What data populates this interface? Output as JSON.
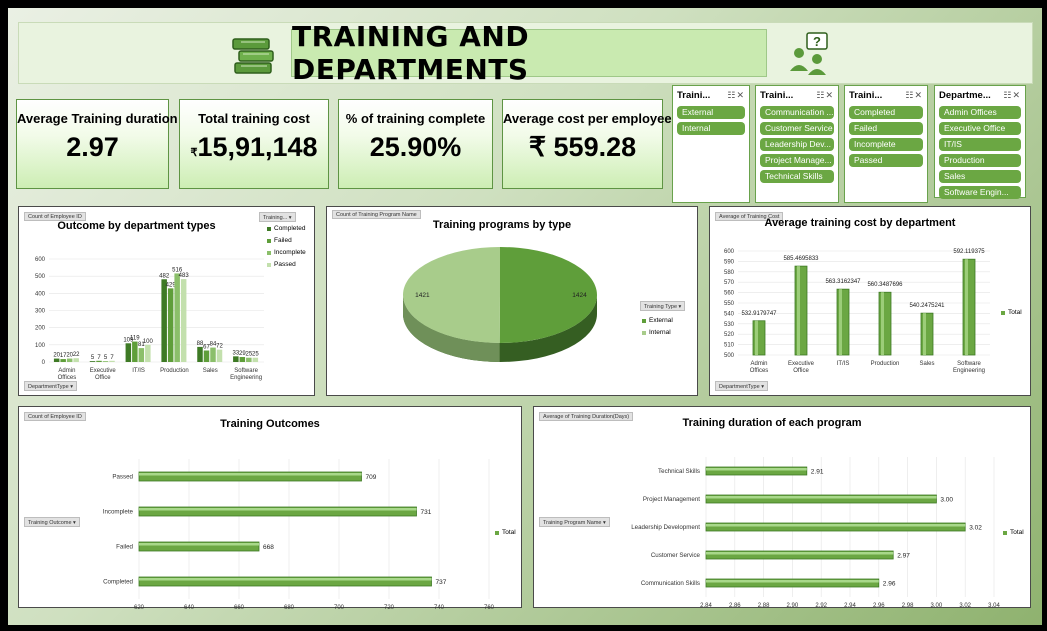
{
  "title": "TRAINING AND DEPARTMENTS",
  "colors": {
    "accent": "#6ba743",
    "dark": "#3e7a25",
    "light": "#a8d08d",
    "pale": "#cfe8bd"
  },
  "kpis": [
    {
      "label": "Average Training duration",
      "value": "2.97",
      "prefix": ""
    },
    {
      "label": "Total training cost",
      "value": "15,91,148",
      "prefix": "₹"
    },
    {
      "label": "% of training complete",
      "value": "25.90%",
      "prefix": ""
    },
    {
      "label": "Average cost per employee",
      "value": "₹ 559.28",
      "prefix": ""
    }
  ],
  "slicers": [
    {
      "title": "Traini...",
      "items": [
        "External",
        "Internal"
      ]
    },
    {
      "title": "Traini...",
      "items": [
        "Communication ...",
        "Customer Service",
        "Leadership Dev...",
        "Project Manage...",
        "Technical Skills"
      ]
    },
    {
      "title": "Traini...",
      "items": [
        "Completed",
        "Failed",
        "Incomplete",
        "Passed"
      ]
    },
    {
      "title": "Departme...",
      "items": [
        "Admin Offices",
        "Executive Office",
        "IT/IS",
        "Production",
        "Sales",
        "Software Engin..."
      ]
    }
  ],
  "panels": {
    "outcome": {
      "field": "Count of Employee ID",
      "drop_top": "Training...",
      "drop_bottom": "DepartmentType"
    },
    "programs": {
      "field": "Count of Training Program Name",
      "drop": "Training Type"
    },
    "avgcost": {
      "field": "Average of Training Cost",
      "drop": "DepartmentType"
    },
    "outcomes": {
      "field": "Count of Employee ID",
      "drop": "Training Outcome"
    },
    "duration": {
      "field": "Average of Training Duration(Days)",
      "drop": "Training Program Name"
    }
  },
  "chart_data": [
    {
      "type": "bar",
      "title": "Outcome by department types",
      "categories": [
        "Admin Offices",
        "Executive Office",
        "IT/IS",
        "Production",
        "Sales",
        "Software Engineering"
      ],
      "series": [
        {
          "name": "Completed",
          "values": [
            20,
            5,
            109,
            482,
            88,
            33
          ]
        },
        {
          "name": "Failed",
          "values": [
            17,
            7,
            119,
            429,
            67,
            29
          ]
        },
        {
          "name": "Incomplete",
          "values": [
            20,
            5,
            81,
            516,
            84,
            25
          ]
        },
        {
          "name": "Passed",
          "values": [
            22,
            7,
            100,
            483,
            72,
            25
          ]
        }
      ],
      "ylim": [
        0,
        600
      ],
      "yticks": [
        0,
        100,
        200,
        300,
        400,
        500,
        600
      ],
      "legend": "right"
    },
    {
      "type": "pie",
      "title": "Training programs by type",
      "categories": [
        "External",
        "Internal"
      ],
      "values": [
        1424,
        1421
      ],
      "legend": "right"
    },
    {
      "type": "bar",
      "title": "Average training cost by department",
      "categories": [
        "Admin Offices",
        "Executive Office",
        "IT/IS",
        "Production",
        "Sales",
        "Software Engineering"
      ],
      "series": [
        {
          "name": "Total",
          "values": [
            532.9179747,
            585.4695833,
            563.3162347,
            560.3487696,
            540.2475241,
            592.119375
          ]
        }
      ],
      "labels": [
        "532.9179747",
        "585.4695833",
        "563.3162347",
        "560.3487696",
        "540.2475241",
        "592.119375"
      ],
      "ylim": [
        500,
        600
      ],
      "yticks": [
        500,
        510,
        520,
        530,
        540,
        550,
        560,
        570,
        580,
        590,
        600
      ],
      "legend": "right"
    },
    {
      "type": "bar",
      "orientation": "horizontal",
      "title": "Training Outcomes",
      "categories": [
        "Passed",
        "Incomplete",
        "Failed",
        "Completed"
      ],
      "series": [
        {
          "name": "Total",
          "values": [
            709,
            731,
            668,
            737
          ]
        }
      ],
      "xlim": [
        620,
        760
      ],
      "xticks": [
        620,
        640,
        660,
        680,
        700,
        720,
        740,
        760
      ],
      "legend": "right"
    },
    {
      "type": "bar",
      "orientation": "horizontal",
      "title": "Training duration of each program",
      "categories": [
        "Technical Skills",
        "Project Management",
        "Leadership Development",
        "Customer Service",
        "Communication Skills"
      ],
      "series": [
        {
          "name": "Total",
          "values": [
            2.91,
            3.0,
            3.02,
            2.97,
            2.96
          ]
        }
      ],
      "labels": [
        "2.91",
        "3.00",
        "3.02",
        "2.97",
        "2.96"
      ],
      "xlim": [
        2.84,
        3.04
      ],
      "xticks": [
        "2.84",
        "2.86",
        "2.88",
        "2.90",
        "2.92",
        "2.94",
        "2.96",
        "2.98",
        "3.00",
        "3.02",
        "3.04"
      ],
      "legend": "right"
    }
  ]
}
